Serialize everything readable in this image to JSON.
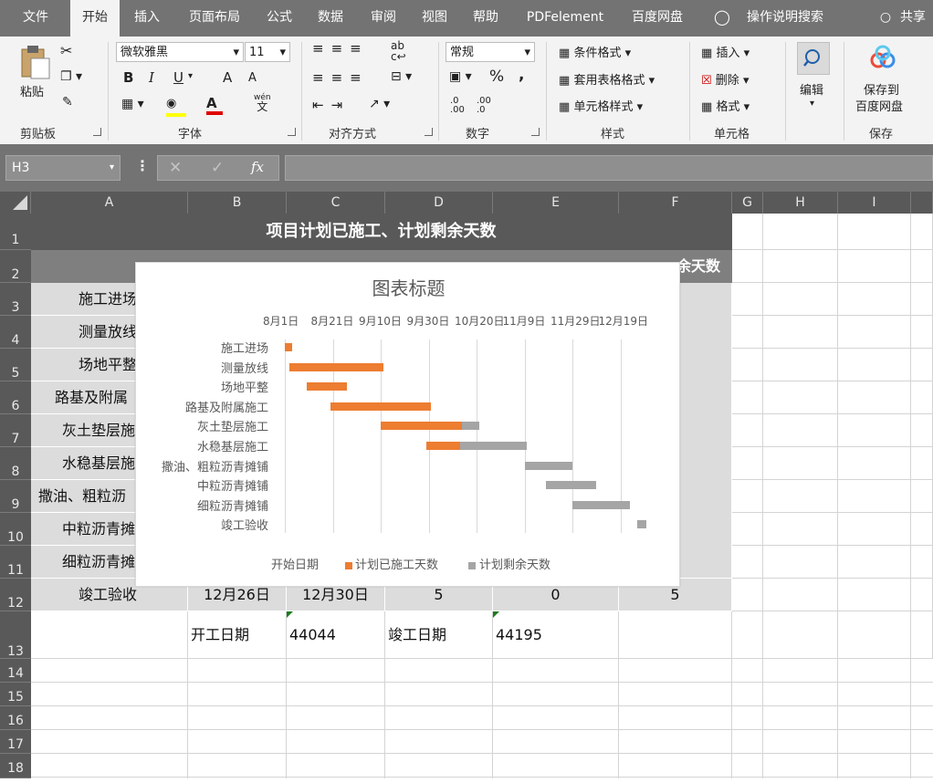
{
  "ribbon_tabs": [
    "文件",
    "开始",
    "插入",
    "页面布局",
    "公式",
    "数据",
    "审阅",
    "视图",
    "帮助",
    "PDFelement",
    "百度网盘",
    "操作说明搜索",
    "共享"
  ],
  "clipboard": {
    "paste": "粘贴",
    "group": "剪贴板"
  },
  "font": {
    "name": "微软雅黑",
    "size": "11",
    "bold": "B",
    "italic": "I",
    "underline": "U",
    "grow": "A",
    "shrink": "A",
    "wen": "wén",
    "wen2": "文",
    "group": "字体"
  },
  "align": {
    "group": "对齐方式",
    "wrap_ab": "ab",
    "wrap_c": "c"
  },
  "number": {
    "format": "常规",
    "percent": "%",
    "comma": ",",
    "inc": ".0 .00",
    "dec": ".00 .0",
    "group": "数字"
  },
  "styles": {
    "cond": "条件格式",
    "table": "套用表格格式",
    "cell": "单元格样式",
    "group": "样式"
  },
  "cells": {
    "insert": "插入",
    "delete": "删除",
    "format": "格式",
    "group": "单元格"
  },
  "editing": {
    "label": "编辑"
  },
  "save": {
    "line1": "保存到",
    "line2": "百度网盘",
    "group": "保存"
  },
  "namebox": "H3",
  "fx": "fx",
  "columns": [
    "A",
    "B",
    "C",
    "D",
    "E",
    "F",
    "G",
    "H",
    "I"
  ],
  "rows": [
    "1",
    "2",
    "3",
    "4",
    "5",
    "6",
    "7",
    "8",
    "9",
    "10",
    "11",
    "12",
    "13",
    "14",
    "15",
    "16",
    "17",
    "18"
  ],
  "sheet": {
    "title": "项目计划已施工、计划剩余天数",
    "f2_header": "余天数",
    "a_col": [
      "施工进场",
      "测量放线",
      "场地平整",
      "路基及附属",
      "灰土垫层施",
      "水稳基层施",
      "撒油、粗粒沥",
      "中粒沥青摊",
      "细粒沥青摊"
    ],
    "row12": {
      "a": "竣工验收",
      "b": "12月26日",
      "c": "12月30日",
      "d": "5",
      "e": "0",
      "f": "5"
    },
    "row13": {
      "b": "开工日期",
      "c": "44044",
      "d": "竣工日期",
      "e": "44195"
    }
  },
  "chart_data": {
    "type": "bar",
    "orientation": "horizontal-stacked-gantt",
    "title": "图表标题",
    "categories": [
      "施工进场",
      "测量放线",
      "场地平整",
      "路基及附属施工",
      "灰土垫层施工",
      "水稳基层施工",
      "撒油、粗粒沥青摊铺",
      "中粒沥青摊铺",
      "细粒沥青摊铺",
      "竣工验收"
    ],
    "x_ticks": [
      "8月1日",
      "8月21日",
      "9月10日",
      "9月30日",
      "10月20日",
      "11月9日",
      "11月29日",
      "12月19日"
    ],
    "x_tick_values": [
      44044,
      44064,
      44084,
      44104,
      44124,
      44144,
      44164,
      44184
    ],
    "xlim": [
      44044,
      44204
    ],
    "series": [
      {
        "name": "开始日期",
        "color": "none",
        "values": [
          44044,
          44046,
          44053,
          44063,
          44084,
          44103,
          44144,
          44153,
          44164,
          44191
        ]
      },
      {
        "name": "计划已施工天数",
        "color": "#ed7d31",
        "values": [
          3,
          39,
          17,
          42,
          34,
          14,
          0,
          0,
          0,
          0
        ]
      },
      {
        "name": "计划剩余天数",
        "color": "#a5a5a5",
        "values": [
          0,
          0,
          0,
          0,
          7,
          28,
          20,
          21,
          24,
          4
        ]
      }
    ],
    "legend": [
      "开始日期",
      "计划已施工天数",
      "计划剩余天数"
    ],
    "legend_position": "bottom",
    "grid": true
  },
  "colors": {
    "tabbar": "#737373",
    "ribbon": "#f3f3f3",
    "header": "#595959",
    "shaded": "#dcdcdc",
    "orange": "#ed7d31",
    "gray": "#a5a5a5"
  }
}
